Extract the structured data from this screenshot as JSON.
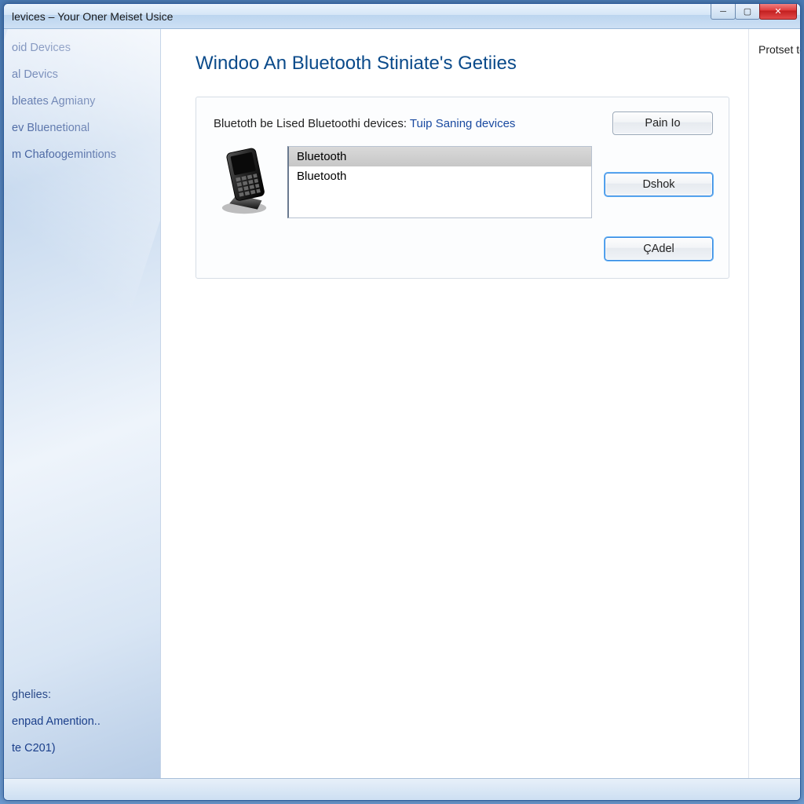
{
  "window": {
    "title": "levices – Your Oner Meiset Usice"
  },
  "sidebar": {
    "nav": [
      "oid Devices",
      "al Devics",
      "bleates Agmiany",
      "ev Bluenetional",
      "m Chafoogemintions"
    ],
    "footer": {
      "label": "ghelies:",
      "line1": "enpad Amention..",
      "line2": "te C201)"
    }
  },
  "page": {
    "title": "Windoo An Bluetooth Stiniate's Getiies"
  },
  "panel": {
    "lead_text": "Bluetoth be Lised Bluetoothi devices:",
    "lead_link": "Tuip Saning devices",
    "pair_button": "Pain Io",
    "dshok_button": "Dshok",
    "cancel_button": "ÇAdel",
    "devices": [
      {
        "name": "Bluetooth",
        "selected": true
      },
      {
        "name": "Bluetooth",
        "selected": false
      }
    ]
  },
  "rightpane": {
    "heading": "Protset to Specices"
  }
}
